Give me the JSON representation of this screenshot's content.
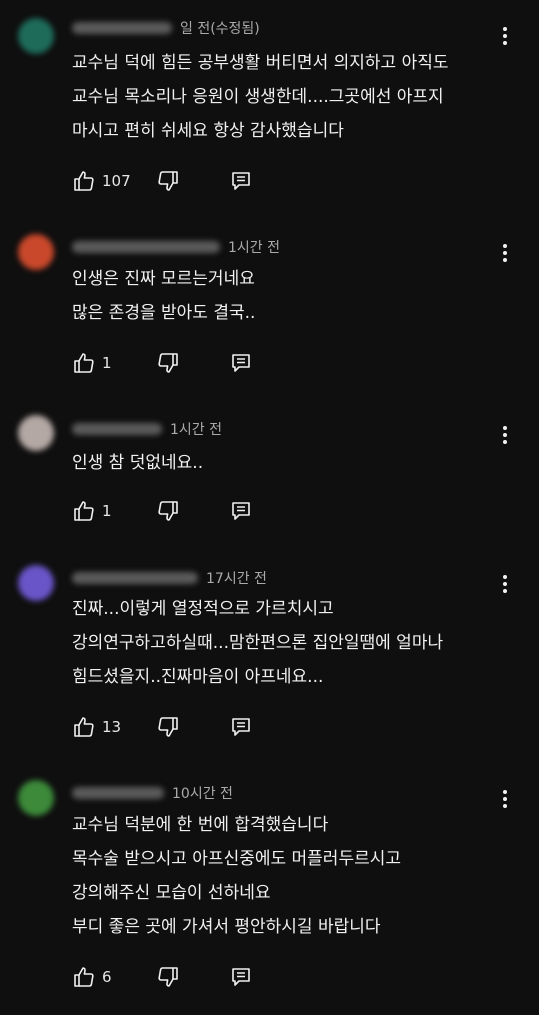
{
  "theme": {
    "background": "#0f0f0f",
    "text": "#f1f1f1",
    "secondary": "#aaaaaa"
  },
  "comments": [
    {
      "avatar_color": "#1e6b5a",
      "time": "일 전(수정됨)",
      "lines": [
        "교수님 덕에 힘든 공부생활 버티면서 의지하고 아직도",
        "교수님 목소리나 응원이 생생한데....그곳에선 아프지",
        "마시고 편히 쉬세요 항상 감사했습니다"
      ],
      "likes": "107",
      "icons": {
        "menu": "more-vert-icon",
        "like": "thumb-up-icon",
        "dislike": "thumb-down-icon",
        "reply": "reply-icon"
      }
    },
    {
      "avatar_color": "#c9482b",
      "time": "1시간 전",
      "lines": [
        "인생은 진짜 모르는거네요",
        "많은 존경을 받아도 결국.."
      ],
      "likes": "1",
      "icons": {
        "menu": "more-vert-icon",
        "like": "thumb-up-icon",
        "dislike": "thumb-down-icon",
        "reply": "reply-icon"
      }
    },
    {
      "avatar_color": "#b4a8a4",
      "time": "1시간 전",
      "lines": [
        "인생 참 덧없네요.."
      ],
      "likes": "1",
      "icons": {
        "menu": "more-vert-icon",
        "like": "thumb-up-icon",
        "dislike": "thumb-down-icon",
        "reply": "reply-icon"
      }
    },
    {
      "avatar_color": "#6a55c8",
      "time": "17시간 전",
      "lines": [
        "진짜...이렇게 열정적으로 가르치시고",
        "강의연구하고하실때...맘한편으론 집안일땜에 얼마나",
        "힘드셨을지..진짜마음이 아프네요..."
      ],
      "likes": "13",
      "icons": {
        "menu": "more-vert-icon",
        "like": "thumb-up-icon",
        "dislike": "thumb-down-icon",
        "reply": "reply-icon"
      }
    },
    {
      "avatar_color": "#3c8a3a",
      "time": "10시간 전",
      "lines": [
        "교수님 덕분에 한 번에 합격했습니다",
        "목수술 받으시고 아프신중에도 머플러두르시고",
        "강의해주신 모습이 선하네요",
        "부디 좋은 곳에 가셔서 평안하시길 바랍니다"
      ],
      "likes": "6",
      "icons": {
        "menu": "more-vert-icon",
        "like": "thumb-up-icon",
        "dislike": "thumb-down-icon",
        "reply": "reply-icon"
      }
    }
  ]
}
